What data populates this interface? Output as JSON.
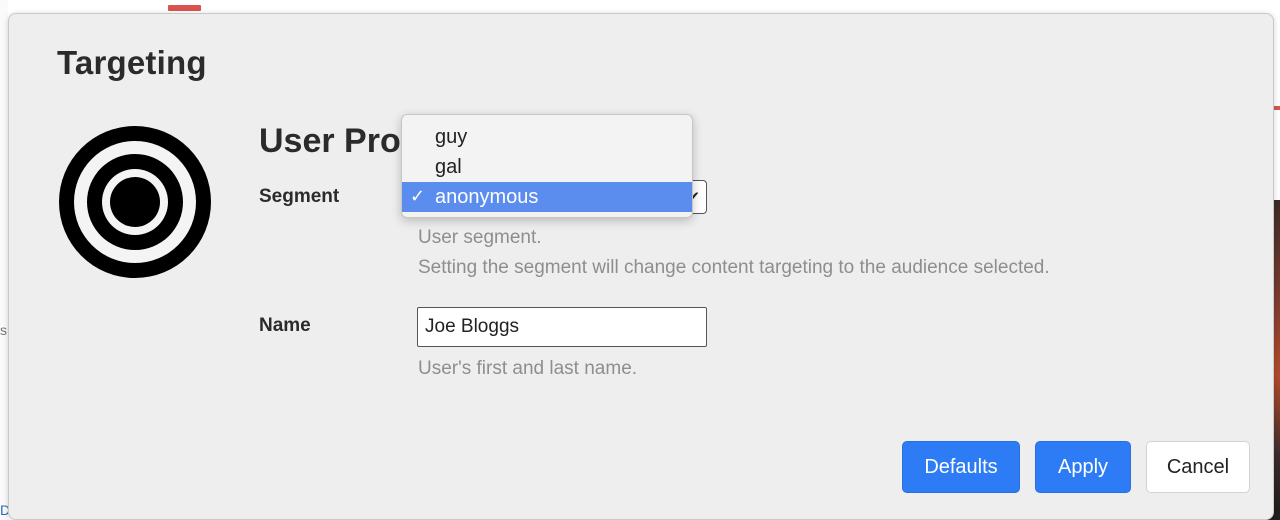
{
  "dialog": {
    "title": "Targeting",
    "icon": "target-icon",
    "section_title": "User Pro",
    "segment": {
      "label": "Segment",
      "selected_value": "anonymous",
      "options": [
        "guy",
        "gal",
        "anonymous"
      ],
      "help_line1": "User segment.",
      "help_line2": "Setting the segment will change content targeting to the audience selected."
    },
    "name": {
      "label": "Name",
      "value": "Joe Bloggs",
      "help": "User's first and last name."
    },
    "buttons": {
      "defaults": "Defaults",
      "apply": "Apply",
      "cancel": "Cancel"
    },
    "colors": {
      "primary": "#2d7cf5",
      "selected_option": "#5b8def",
      "dialog_bg": "#eeeeee"
    }
  },
  "background": {
    "left_char": "s",
    "left_blue_char": "D"
  }
}
